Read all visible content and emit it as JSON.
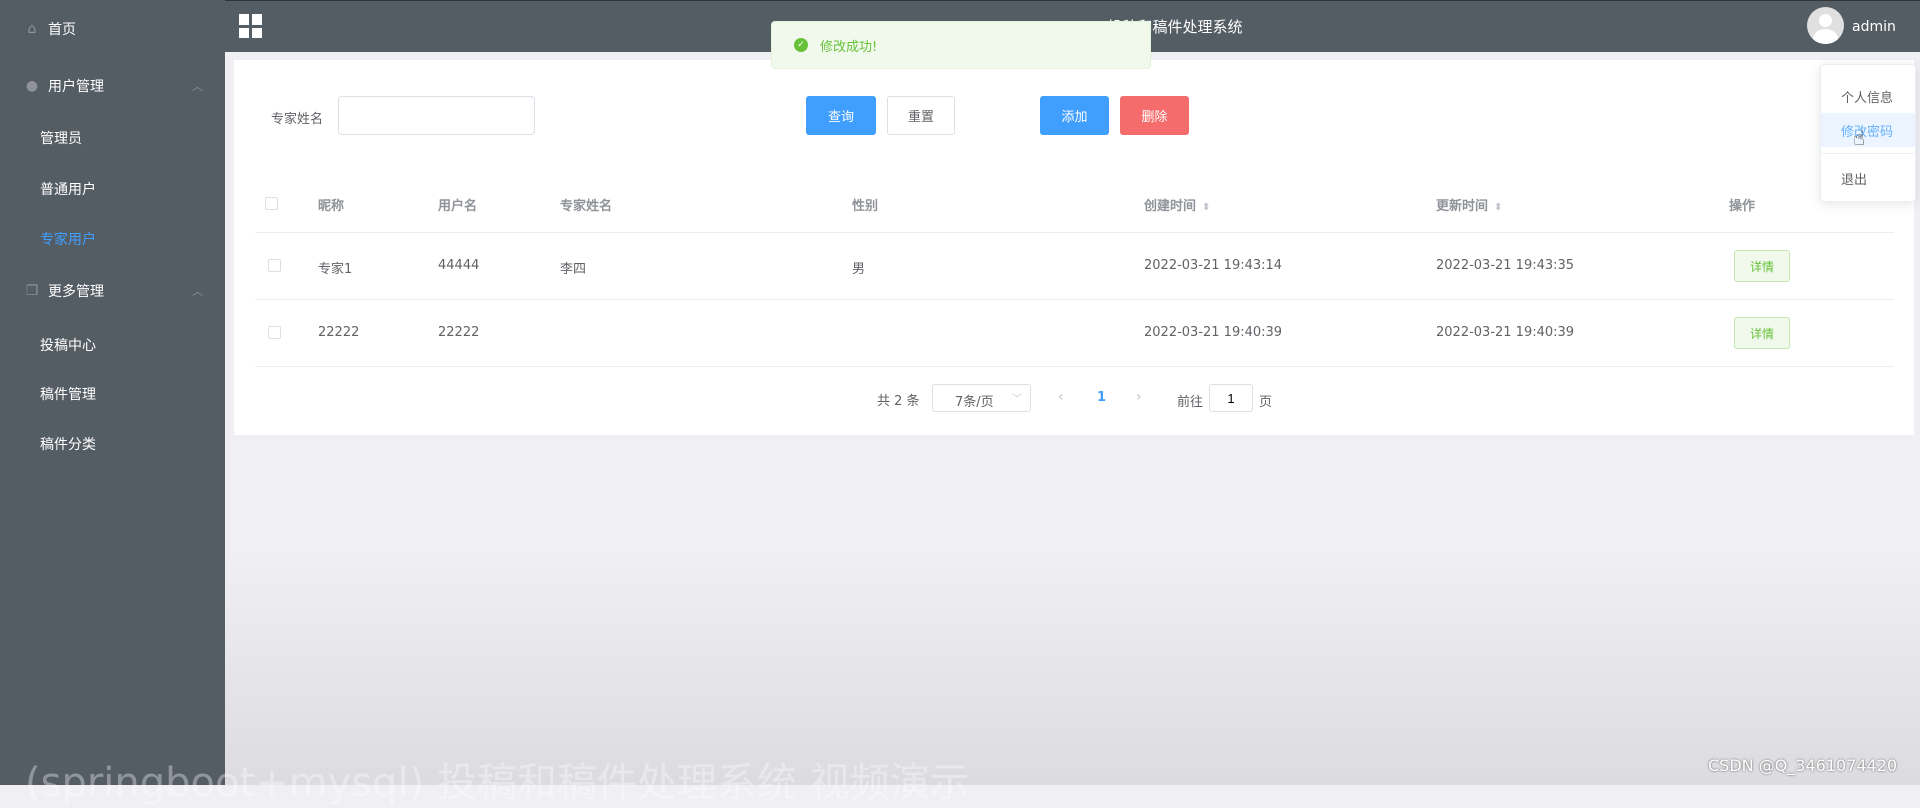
{
  "header": {
    "title": "投稿和稿件处理系统",
    "user": "admin"
  },
  "sidebar": {
    "items": [
      {
        "label": "首页",
        "icon": "home-icon"
      },
      {
        "label": "用户管理",
        "icon": "user-icon"
      },
      {
        "label": "管理员"
      },
      {
        "label": "普通用户"
      },
      {
        "label": "专家用户"
      },
      {
        "label": "更多管理",
        "icon": "copy-icon"
      },
      {
        "label": "投稿中心"
      },
      {
        "label": "稿件管理"
      },
      {
        "label": "稿件分类"
      }
    ]
  },
  "toast": {
    "message": "修改成功!"
  },
  "dropdown": {
    "items": [
      "个人信息",
      "修改密码",
      "退出"
    ]
  },
  "search": {
    "label": "专家姓名",
    "value": "",
    "query": "查询",
    "reset": "重置",
    "add": "添加",
    "delete": "删除"
  },
  "table": {
    "headers": [
      "昵称",
      "用户名",
      "专家姓名",
      "性别",
      "创建时间",
      "更新时间",
      "操作"
    ],
    "rows": [
      {
        "nickname": "专家1",
        "username": "44444",
        "name": "李四",
        "gender": "男",
        "created": "2022-03-21 19:43:14",
        "updated": "2022-03-21 19:43:35",
        "action": "详情"
      },
      {
        "nickname": "22222",
        "username": "22222",
        "name": "",
        "gender": "",
        "created": "2022-03-21 19:40:39",
        "updated": "2022-03-21 19:40:39",
        "action": "详情"
      }
    ]
  },
  "pagination": {
    "total": "共 2 条",
    "page_size": "7条/页",
    "current": "1",
    "goto_label": "前往",
    "goto_value": "1",
    "page_suffix": "页"
  },
  "watermark": {
    "left": "(springboot+mysql) 投稿和稿件处理系统 视频演示",
    "right": "CSDN @Q_3461074420"
  }
}
